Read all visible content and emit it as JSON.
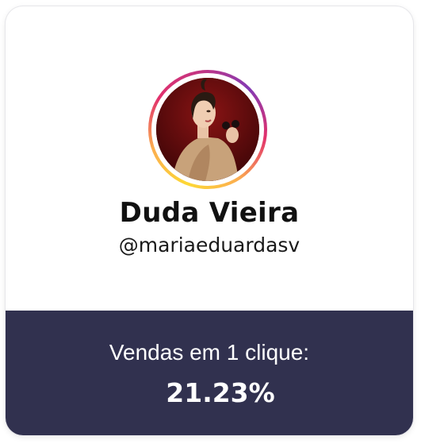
{
  "profile": {
    "name": "Duda Vieira",
    "handle": "@mariaeduardasv",
    "avatar_ring_colors": [
      "#fdd835",
      "#fbad50",
      "#e1306c",
      "#c13584",
      "#833ab4"
    ]
  },
  "stats": {
    "label": "Vendas em 1 clique:",
    "value": "21.23%",
    "background": "#31314f"
  }
}
